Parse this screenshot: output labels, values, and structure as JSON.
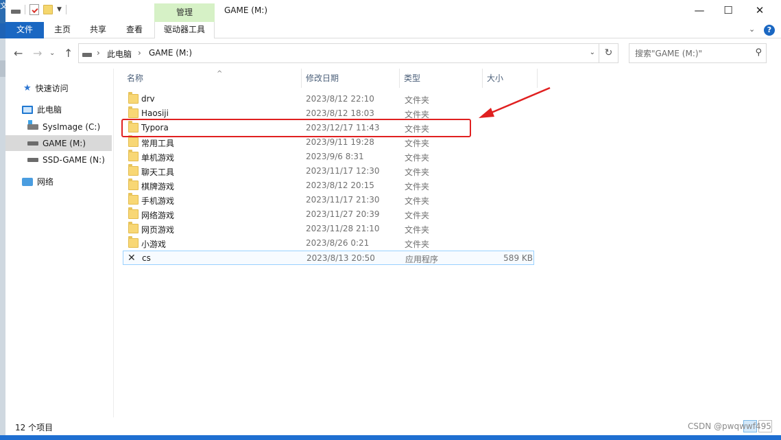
{
  "window": {
    "title": "GAME (M:)",
    "contextual_group": "管理",
    "minimize": "—",
    "maximize": "☐",
    "close": "✕"
  },
  "ribbon": {
    "tabs": [
      "文件",
      "主页",
      "共享",
      "查看",
      "驱动器工具"
    ],
    "collapse_glyph": "⌄",
    "help_glyph": "?"
  },
  "address": {
    "crumbs": [
      "此电脑",
      "GAME (M:)"
    ],
    "separator": "›",
    "search_placeholder": "搜索\"GAME (M:)\""
  },
  "nav": {
    "quick_access": "快速访问",
    "this_pc": "此电脑",
    "drives": [
      "SysImage (C:)",
      "GAME (M:)",
      "SSD-GAME (N:)"
    ],
    "network": "网络"
  },
  "columns": [
    "名称",
    "修改日期",
    "类型",
    "大小"
  ],
  "files": [
    {
      "name": "drv",
      "date": "2023/8/12 22:10",
      "type": "文件夹",
      "size": ""
    },
    {
      "name": "Haosiji",
      "date": "2023/8/12 18:03",
      "type": "文件夹",
      "size": ""
    },
    {
      "name": "Typora",
      "date": "2023/12/17 11:43",
      "type": "文件夹",
      "size": ""
    },
    {
      "name": "常用工具",
      "date": "2023/9/11 19:28",
      "type": "文件夹",
      "size": ""
    },
    {
      "name": "单机游戏",
      "date": "2023/9/6 8:31",
      "type": "文件夹",
      "size": ""
    },
    {
      "name": "聊天工具",
      "date": "2023/11/17 12:30",
      "type": "文件夹",
      "size": ""
    },
    {
      "name": "棋牌游戏",
      "date": "2023/8/12 20:15",
      "type": "文件夹",
      "size": ""
    },
    {
      "name": "手机游戏",
      "date": "2023/11/17 21:30",
      "type": "文件夹",
      "size": ""
    },
    {
      "name": "网络游戏",
      "date": "2023/11/27 20:39",
      "type": "文件夹",
      "size": ""
    },
    {
      "name": "网页游戏",
      "date": "2023/11/28 21:10",
      "type": "文件夹",
      "size": ""
    },
    {
      "name": "小游戏",
      "date": "2023/8/26 0:21",
      "type": "文件夹",
      "size": ""
    },
    {
      "name": "cs",
      "date": "2023/8/13 20:50",
      "type": "应用程序",
      "size": "589 KB"
    }
  ],
  "status": {
    "item_count": "12 个项目"
  },
  "watermark": "CSDN @pwqwwf495",
  "colors": {
    "file_tab": "#1a67c2",
    "manage_tab": "#d6f1c6",
    "highlight": "#e02020"
  }
}
